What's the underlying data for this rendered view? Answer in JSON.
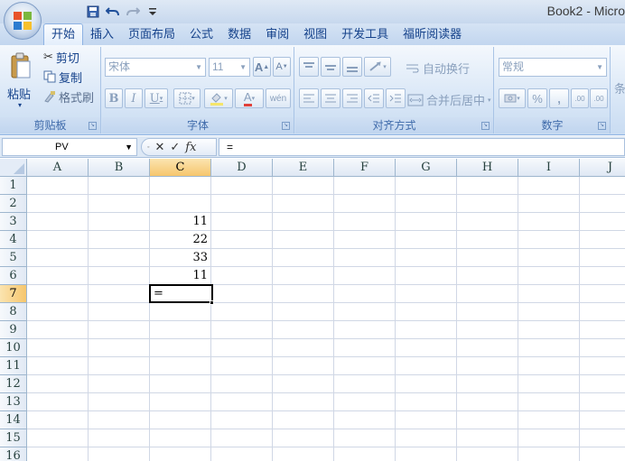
{
  "window": {
    "title": "Book2 - Micro"
  },
  "tabs": [
    "开始",
    "插入",
    "页面布局",
    "公式",
    "数据",
    "审阅",
    "视图",
    "开发工具",
    "福昕阅读器"
  ],
  "clipboard": {
    "paste": "粘贴",
    "cut": "剪切",
    "copy": "复制",
    "format_painter": "格式刷",
    "group_label": "剪贴板"
  },
  "font": {
    "name": "宋体",
    "size": "11",
    "bold": "B",
    "italic": "I",
    "underline": "U",
    "grow": "A",
    "shrink": "A",
    "font_color": "A",
    "phonetic": "wén",
    "group_label": "字体"
  },
  "alignment": {
    "wrap_text": "自动换行",
    "merge_center": "合并后居中",
    "group_label": "对齐方式"
  },
  "number": {
    "format": "常规",
    "percent": "%",
    "comma": ",",
    "inc_decimal": ".00",
    "dec_decimal": ".00",
    "group_label": "数字"
  },
  "styles": {
    "partial_label": "条"
  },
  "formula_bar": {
    "name_box": "PV",
    "formula": "="
  },
  "grid": {
    "columns": [
      "A",
      "B",
      "C",
      "D",
      "E",
      "F",
      "G",
      "H",
      "I",
      "J"
    ],
    "rows": [
      "1",
      "2",
      "3",
      "4",
      "5",
      "6",
      "7",
      "8",
      "9",
      "10",
      "11",
      "12",
      "13",
      "14",
      "15",
      "16"
    ],
    "active_column": "C",
    "active_row": "7",
    "cells": {
      "C3": "11",
      "C4": "22",
      "C5": "33",
      "C6": "11",
      "C7": "="
    }
  },
  "colors": {
    "accent": "#15428b",
    "selection": "#f6c66d",
    "ribbon": "#dbe8f7"
  }
}
